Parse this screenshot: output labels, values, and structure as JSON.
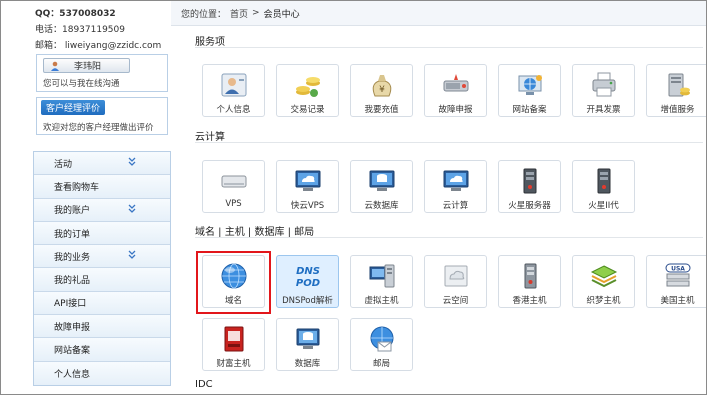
{
  "sidebar": {
    "qq": "QQ：537008032",
    "phone": "电话：18937119509",
    "email": "邮箱：   liweiyang@zzidc.com",
    "manager": {
      "name": "李玮阳",
      "note": "您可以与我在线沟通"
    },
    "evaluate": {
      "button": "客户经理评价",
      "note": "欢迎对您的客户经理做出评价"
    },
    "menu": [
      {
        "label": "活动",
        "expand": true
      },
      {
        "label": "查看购物车",
        "expand": false
      },
      {
        "label": "我的账户",
        "expand": true
      },
      {
        "label": "我的订单",
        "expand": false
      },
      {
        "label": "我的业务",
        "expand": true
      },
      {
        "label": "我的礼品",
        "expand": false
      },
      {
        "label": "API接口",
        "expand": false
      },
      {
        "label": "故障申报",
        "expand": false
      },
      {
        "label": "网站备案",
        "expand": false
      },
      {
        "label": "个人信息",
        "expand": false
      }
    ]
  },
  "breadcrumb": {
    "prefix": "您的位置：",
    "home": "首页",
    "sep": ">",
    "current": "会员中心"
  },
  "sections": {
    "service": {
      "title": "服务项",
      "items": [
        {
          "label": "个人信息",
          "icon": "person-card-icon"
        },
        {
          "label": "交易记录",
          "icon": "coins-icon"
        },
        {
          "label": "我要充值",
          "icon": "money-bag-icon"
        },
        {
          "label": "故障申报",
          "icon": "broken-disk-icon"
        },
        {
          "label": "网站备案",
          "icon": "globe-network-icon"
        },
        {
          "label": "开具发票",
          "icon": "printer-icon"
        },
        {
          "label": "增值服务",
          "icon": "server-coins-icon"
        }
      ]
    },
    "cloud": {
      "title": "云计算",
      "items": [
        {
          "label": "VPS",
          "icon": "drive-icon"
        },
        {
          "label": "快云VPS",
          "icon": "cloud-monitor-icon"
        },
        {
          "label": "云数据库",
          "icon": "database-monitor-icon"
        },
        {
          "label": "云计算",
          "icon": "cloud-monitor-icon"
        },
        {
          "label": "火星服务器",
          "icon": "tower-server-icon"
        },
        {
          "label": "火星II代",
          "icon": "tower-server-icon"
        }
      ]
    },
    "domain": {
      "title": "域名 | 主机 | 数据库 | 邮局",
      "items": [
        {
          "label": "域名",
          "icon": "globe-icon"
        },
        {
          "label": "DNSPod解析",
          "icon": "dnspod-logo-icon"
        },
        {
          "label": "虚拟主机",
          "icon": "virtual-host-icon"
        },
        {
          "label": "云空间",
          "icon": "cloud-space-icon"
        },
        {
          "label": "香港主机",
          "icon": "hk-server-icon"
        },
        {
          "label": "织梦主机",
          "icon": "layers-icon"
        },
        {
          "label": "美国主机",
          "icon": "usa-server-icon"
        },
        {
          "label": "财富主机",
          "icon": "red-server-icon"
        },
        {
          "label": "数据库",
          "icon": "database-icon"
        },
        {
          "label": "邮局",
          "icon": "mail-globe-icon"
        }
      ]
    },
    "idc": {
      "title": "IDC"
    }
  },
  "dnspod_logo": [
    "DNS",
    "POD"
  ]
}
